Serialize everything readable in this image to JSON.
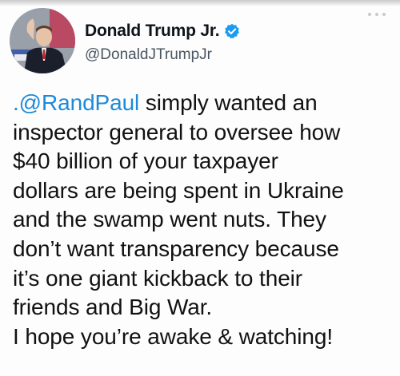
{
  "author": {
    "display_name": "Donald Trump Jr.",
    "handle": "@DonaldJTrumpJr",
    "verified": true
  },
  "tweet": {
    "mention": ".@RandPaul",
    "lines": [
      " simply wanted an",
      "inspector general to oversee how",
      "$40 billion of your taxpayer",
      "dollars are being spent in Ukraine",
      "and the swamp went nuts. They",
      "don’t want transparency because",
      "it’s one giant kickback to their",
      "friends and Big War.",
      "I hope you’re awake & watching!"
    ]
  },
  "icons": {
    "verified": "verified-badge-icon",
    "more": "more-options-icon"
  },
  "colors": {
    "mention": "#1d8ad8",
    "verified": "#1d9bf0",
    "handle": "#4a5561",
    "text": "#111111"
  }
}
